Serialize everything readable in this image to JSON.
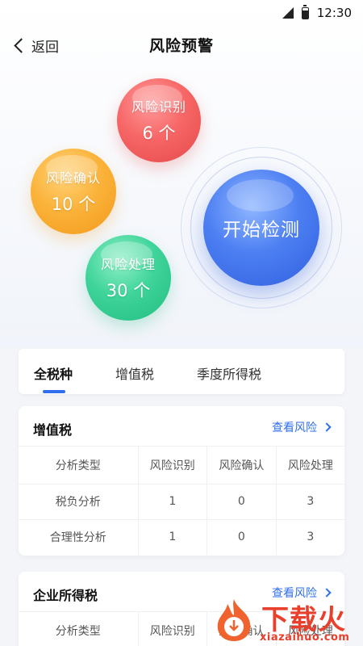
{
  "status_bar": {
    "time": "12:30"
  },
  "nav": {
    "back_label": "返回",
    "title": "风险预警"
  },
  "bubbles": [
    {
      "label": "风险识别",
      "count": "6 个",
      "color": "#f76767"
    },
    {
      "label": "风险确认",
      "count": "10 个",
      "color": "#fbb33b"
    },
    {
      "label": "风险处理",
      "count": "30 个",
      "color": "#3fd49a"
    }
  ],
  "detect_button": {
    "label": "开始检测",
    "color": "#4d7ff2"
  },
  "tabs": [
    {
      "label": "全税种",
      "active": true
    },
    {
      "label": "增值税",
      "active": false
    },
    {
      "label": "季度所得税",
      "active": false
    }
  ],
  "accent_color": "#2f6fed",
  "cards": [
    {
      "title": "增值税",
      "link": "查看风险",
      "columns": [
        "分析类型",
        "风险识别",
        "风险确认",
        "风险处理"
      ],
      "rows": [
        [
          "税负分析",
          "1",
          "0",
          "3"
        ],
        [
          "合理性分析",
          "1",
          "0",
          "3"
        ]
      ]
    },
    {
      "title": "企业所得税",
      "link": "查看风险",
      "columns": [
        "分析类型",
        "风险识别",
        "风险确认",
        "风险处理"
      ],
      "rows": []
    }
  ],
  "watermark": {
    "brand": "下载火",
    "url": "xiazaihuo.com"
  }
}
